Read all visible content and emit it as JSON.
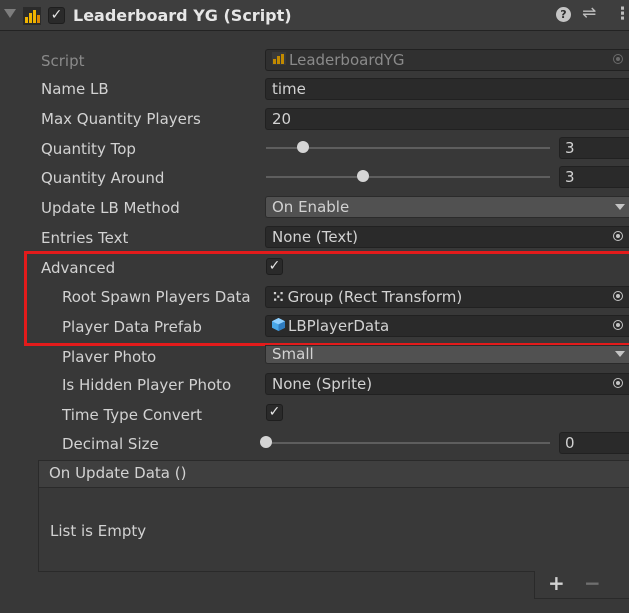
{
  "header": {
    "title": "Leaderboard YG (Script)",
    "enabled": true,
    "icons": [
      "fold-arrow-icon",
      "script-icon",
      "help-icon",
      "presets-icon",
      "kebab-menu-icon"
    ]
  },
  "fields": {
    "script": {
      "label": "Script",
      "value": "LeaderboardYG"
    },
    "name_lb": {
      "label": "Name LB",
      "value": "time"
    },
    "max_quantity_players": {
      "label": "Max Quantity Players",
      "value": "20"
    },
    "quantity_top": {
      "label": "Quantity Top",
      "value": "3",
      "fraction": 0.13
    },
    "quantity_around": {
      "label": "Quantity Around",
      "value": "3",
      "fraction": 0.34
    },
    "update_lb_method": {
      "label": "Update LB Method",
      "value": "On Enable"
    },
    "entries_text": {
      "label": "Entries Text",
      "value": "None (Text)"
    },
    "advanced": {
      "label": "Advanced",
      "checked": true
    },
    "root_spawn": {
      "label": "Root Spawn Players Data",
      "value": "Group (Rect Transform)"
    },
    "player_data_prefab": {
      "label": "Player Data Prefab",
      "value": "LBPlayerData"
    },
    "player_photo": {
      "label": "Player Photo",
      "value": "Small"
    },
    "is_hidden_player_photo": {
      "label": "Is Hidden Player Photo",
      "value": "None (Sprite)"
    },
    "time_type_convert": {
      "label": "Time Type Convert",
      "checked": true
    },
    "decimal_size": {
      "label": "Decimal Size",
      "value": "0",
      "fraction": 0.0
    }
  },
  "event": {
    "title": "On Update Data ()",
    "empty_text": "List is Empty",
    "add_label": "+",
    "remove_label": "−"
  },
  "colors": {
    "background": "#383838",
    "highlight": "#e31b1b"
  },
  "check_glyph": "✓"
}
